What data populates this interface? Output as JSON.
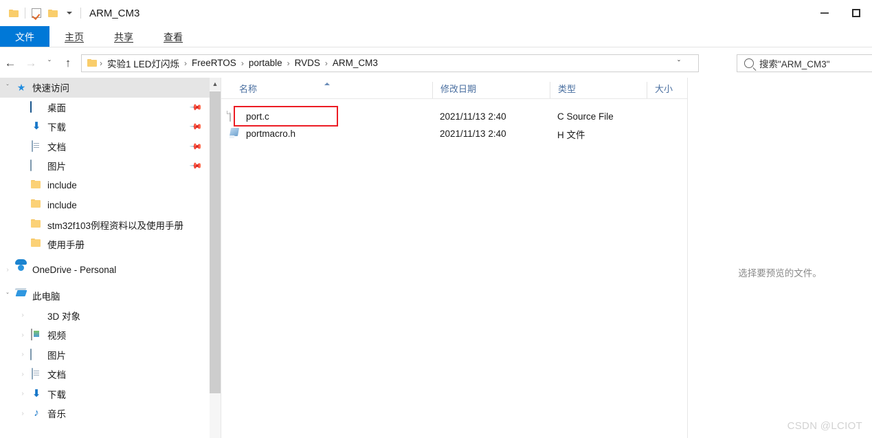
{
  "window": {
    "title": "ARM_CM3",
    "quick_access_toolbar": [
      {
        "name": "folder-icon",
        "label": "文件夹"
      },
      {
        "name": "properties-icon",
        "label": "属性"
      },
      {
        "name": "new-folder-icon",
        "label": "新建文件夹"
      },
      {
        "name": "customize-dropdown-icon",
        "label": "自定义快速访问工具栏"
      }
    ],
    "controls": {
      "minimize": "—",
      "maximize": "☐"
    }
  },
  "ribbon": {
    "tabs": [
      {
        "label": "文件",
        "active": true
      },
      {
        "label": "主页",
        "active": false
      },
      {
        "label": "共享",
        "active": false
      },
      {
        "label": "查看",
        "active": false
      }
    ]
  },
  "addressbar": {
    "back": "←",
    "forward": "→",
    "recent": "ˇ",
    "up": "↑",
    "breadcrumbs": [
      "实验1 LED灯闪烁",
      "FreeRTOS",
      "portable",
      "RVDS",
      "ARM_CM3"
    ],
    "separator": "›",
    "dropdown": "ˇ",
    "refresh": "↻",
    "search_placeholder": "搜索\"ARM_CM3\""
  },
  "navpane": {
    "items": [
      {
        "label": "快速访问",
        "icon": "star-icon",
        "chevron": "expanded",
        "indent": 1,
        "selected": true,
        "pinned": false
      },
      {
        "label": "桌面",
        "icon": "desktop-icon",
        "chevron": "none",
        "indent": 2,
        "selected": false,
        "pinned": true
      },
      {
        "label": "下载",
        "icon": "download-icon",
        "chevron": "none",
        "indent": 2,
        "selected": false,
        "pinned": true
      },
      {
        "label": "文档",
        "icon": "documents-icon",
        "chevron": "none",
        "indent": 2,
        "selected": false,
        "pinned": true
      },
      {
        "label": "图片",
        "icon": "pictures-icon",
        "chevron": "none",
        "indent": 2,
        "selected": false,
        "pinned": true
      },
      {
        "label": "include",
        "icon": "folder-icon",
        "chevron": "none",
        "indent": 2,
        "selected": false,
        "pinned": false
      },
      {
        "label": "include",
        "icon": "folder-icon",
        "chevron": "none",
        "indent": 2,
        "selected": false,
        "pinned": false
      },
      {
        "label": "stm32f103例程资料以及使用手册",
        "icon": "folder-icon",
        "chevron": "none",
        "indent": 2,
        "selected": false,
        "pinned": false
      },
      {
        "label": "使用手册",
        "icon": "folder-icon",
        "chevron": "none",
        "indent": 2,
        "selected": false,
        "pinned": false
      },
      {
        "label": "OneDrive - Personal",
        "icon": "onedrive-icon",
        "chevron": "collapsed",
        "indent": 1,
        "selected": false,
        "pinned": false
      },
      {
        "label": "此电脑",
        "icon": "this-pc-icon",
        "chevron": "expanded",
        "indent": 1,
        "selected": false,
        "pinned": false
      },
      {
        "label": "3D 对象",
        "icon": "3d-objects-icon",
        "chevron": "collapsed",
        "indent": 2,
        "selected": false,
        "pinned": false
      },
      {
        "label": "视频",
        "icon": "videos-icon",
        "chevron": "collapsed",
        "indent": 2,
        "selected": false,
        "pinned": false
      },
      {
        "label": "图片",
        "icon": "pictures-icon",
        "chevron": "collapsed",
        "indent": 2,
        "selected": false,
        "pinned": false
      },
      {
        "label": "文档",
        "icon": "documents-icon",
        "chevron": "collapsed",
        "indent": 2,
        "selected": false,
        "pinned": false
      },
      {
        "label": "下载",
        "icon": "download-icon",
        "chevron": "collapsed",
        "indent": 2,
        "selected": false,
        "pinned": false
      },
      {
        "label": "音乐",
        "icon": "music-icon",
        "chevron": "collapsed",
        "indent": 2,
        "selected": false,
        "pinned": false
      }
    ],
    "chevron_expanded": "ˇ",
    "chevron_collapsed": "›",
    "pin_glyph": "✒"
  },
  "filelist": {
    "columns": [
      {
        "label": "名称",
        "sorted": true
      },
      {
        "label": "修改日期",
        "sorted": false
      },
      {
        "label": "类型",
        "sorted": false
      },
      {
        "label": "大小",
        "sorted": false
      }
    ],
    "rows": [
      {
        "name": "port.c",
        "icon": "c-source-file-icon",
        "date": "2021/11/13 2:40",
        "type": "C Source File",
        "size": "",
        "highlighted": true
      },
      {
        "name": "portmacro.h",
        "icon": "h-file-icon",
        "date": "2021/11/13 2:40",
        "type": "H 文件",
        "size": "",
        "highlighted": false
      }
    ],
    "highlight_color": "#ec1c24"
  },
  "previewpane": {
    "message": "选择要预览的文件。"
  },
  "watermark": {
    "text": "CSDN @LCIOT"
  },
  "theme": {
    "accent": "#0078d7",
    "column_header_text": "#4a6fa0",
    "selection_bg": "#e5e5e5"
  }
}
